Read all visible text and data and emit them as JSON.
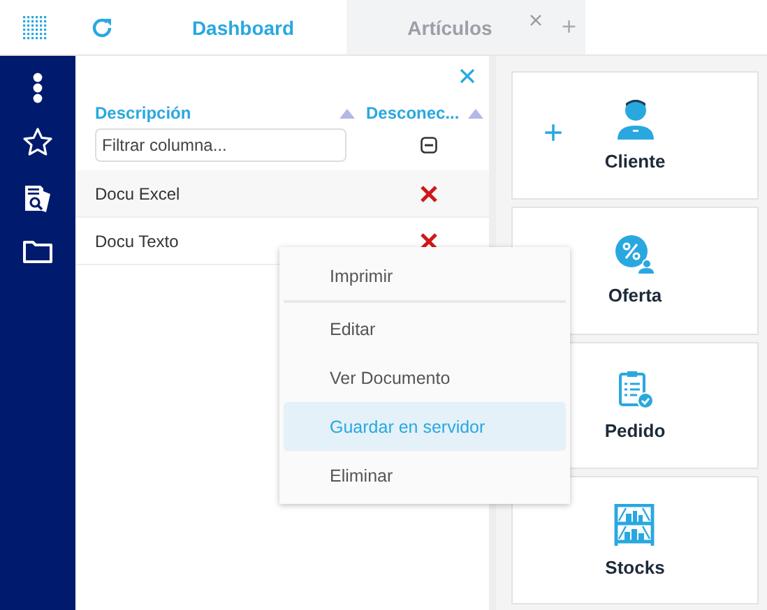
{
  "tabs": [
    {
      "label": "Dashboard",
      "selected": true,
      "closable": false
    },
    {
      "label": "Artículos",
      "selected": false,
      "closable": true
    }
  ],
  "add_tab": "+",
  "table": {
    "columns": [
      {
        "label": "Descripción"
      },
      {
        "label": "Desconec..."
      }
    ],
    "filter": {
      "placeholder": "Filtrar columna...",
      "indeterminate": true
    },
    "rows": [
      {
        "description": "Docu Excel",
        "disconnected": false
      },
      {
        "description": "Docu Texto",
        "disconnected": false
      }
    ]
  },
  "context_menu": [
    {
      "label": "Imprimir",
      "selected": false,
      "separator_after": true
    },
    {
      "label": "Editar",
      "selected": false,
      "separator_after": false
    },
    {
      "label": "Ver Documento",
      "selected": false,
      "separator_after": false
    },
    {
      "label": "Guardar en servidor",
      "selected": true,
      "separator_after": false
    },
    {
      "label": "Eliminar",
      "selected": false,
      "separator_after": false
    }
  ],
  "cards": [
    {
      "label": "Cliente",
      "kind": "customer",
      "add": "+"
    },
    {
      "label": "Oferta",
      "kind": "offer"
    },
    {
      "label": "Pedido",
      "kind": "order"
    },
    {
      "label": "Stocks",
      "kind": "stock"
    }
  ]
}
